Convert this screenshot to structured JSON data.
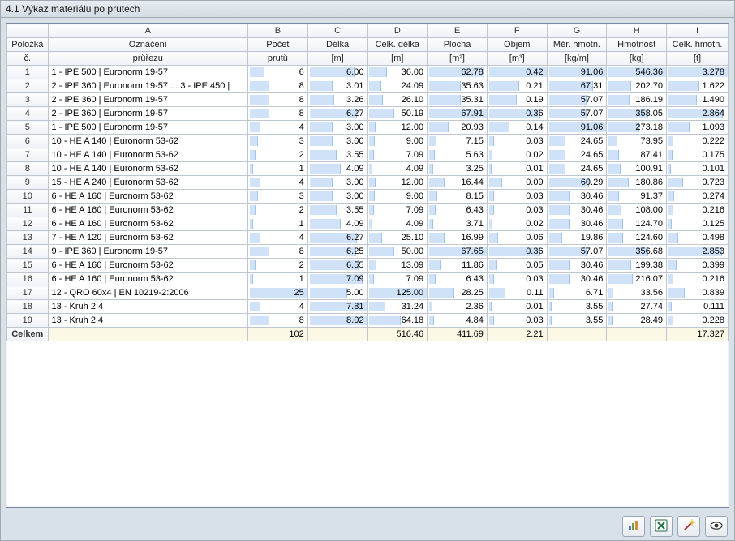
{
  "title": "4.1 Výkaz materiálu po prutech",
  "columns": {
    "letters": [
      "",
      "A",
      "B",
      "C",
      "D",
      "E",
      "F",
      "G",
      "H",
      "I"
    ],
    "row1": [
      "Položka",
      "Označení",
      "Počet",
      "Délka",
      "Celk. délka",
      "Plocha",
      "Objem",
      "Měr. hmotn.",
      "Hmotnost",
      "Celk. hmotn."
    ],
    "row2": [
      "č.",
      "průřezu",
      "prutů",
      "[m]",
      "[m]",
      "[m²]",
      "[m³]",
      "[kg/m]",
      "[kg]",
      "[t]"
    ]
  },
  "bar_max": {
    "count": 25,
    "length": 8.02,
    "total_length": 125.0,
    "area": 67.91,
    "volume": 0.42,
    "unit_mass": 91.06,
    "mass": 546.36,
    "total_mass": 3.278
  },
  "rows": [
    {
      "n": "1",
      "desc": "1 - IPE 500 | Euronorm 19-57",
      "count": 6,
      "length": "6.00",
      "total_length": "36.00",
      "area": "62.78",
      "volume": "0.42",
      "unit_mass": "91.06",
      "mass": "546.36",
      "total_mass": "3.278"
    },
    {
      "n": "2",
      "desc": "2 - IPE 360 | Euronorm 19-57 ... 3 - IPE 450 |",
      "count": 8,
      "length": "3.01",
      "total_length": "24.09",
      "area": "35.63",
      "volume": "0.21",
      "unit_mass": "67.31",
      "mass": "202.70",
      "total_mass": "1.622"
    },
    {
      "n": "3",
      "desc": "2 - IPE 360 | Euronorm 19-57",
      "count": 8,
      "length": "3.26",
      "total_length": "26.10",
      "area": "35.31",
      "volume": "0.19",
      "unit_mass": "57.07",
      "mass": "186.19",
      "total_mass": "1.490"
    },
    {
      "n": "4",
      "desc": "2 - IPE 360 | Euronorm 19-57",
      "count": 8,
      "length": "6.27",
      "total_length": "50.19",
      "area": "67.91",
      "volume": "0.36",
      "unit_mass": "57.07",
      "mass": "358.05",
      "total_mass": "2.864"
    },
    {
      "n": "5",
      "desc": "1 - IPE 500 | Euronorm 19-57",
      "count": 4,
      "length": "3.00",
      "total_length": "12.00",
      "area": "20.93",
      "volume": "0.14",
      "unit_mass": "91.06",
      "mass": "273.18",
      "total_mass": "1.093"
    },
    {
      "n": "6",
      "desc": "10 - HE A 140 | Euronorm 53-62",
      "count": 3,
      "length": "3.00",
      "total_length": "9.00",
      "area": "7.15",
      "volume": "0.03",
      "unit_mass": "24.65",
      "mass": "73.95",
      "total_mass": "0.222"
    },
    {
      "n": "7",
      "desc": "10 - HE A 140 | Euronorm 53-62",
      "count": 2,
      "length": "3.55",
      "total_length": "7.09",
      "area": "5.63",
      "volume": "0.02",
      "unit_mass": "24.65",
      "mass": "87.41",
      "total_mass": "0.175"
    },
    {
      "n": "8",
      "desc": "10 - HE A 140 | Euronorm 53-62",
      "count": 1,
      "length": "4.09",
      "total_length": "4.09",
      "area": "3.25",
      "volume": "0.01",
      "unit_mass": "24.65",
      "mass": "100.91",
      "total_mass": "0.101"
    },
    {
      "n": "9",
      "desc": "15 - HE A 240 | Euronorm 53-62",
      "count": 4,
      "length": "3.00",
      "total_length": "12.00",
      "area": "16.44",
      "volume": "0.09",
      "unit_mass": "60.29",
      "mass": "180.86",
      "total_mass": "0.723"
    },
    {
      "n": "10",
      "desc": "6 - HE A 160 | Euronorm 53-62",
      "count": 3,
      "length": "3.00",
      "total_length": "9.00",
      "area": "8.15",
      "volume": "0.03",
      "unit_mass": "30.46",
      "mass": "91.37",
      "total_mass": "0.274"
    },
    {
      "n": "11",
      "desc": "6 - HE A 160 | Euronorm 53-62",
      "count": 2,
      "length": "3.55",
      "total_length": "7.09",
      "area": "6.43",
      "volume": "0.03",
      "unit_mass": "30.46",
      "mass": "108.00",
      "total_mass": "0.216"
    },
    {
      "n": "12",
      "desc": "6 - HE A 160 | Euronorm 53-62",
      "count": 1,
      "length": "4.09",
      "total_length": "4.09",
      "area": "3.71",
      "volume": "0.02",
      "unit_mass": "30.46",
      "mass": "124.70",
      "total_mass": "0.125"
    },
    {
      "n": "13",
      "desc": "7 - HE A 120 | Euronorm 53-62",
      "count": 4,
      "length": "6.27",
      "total_length": "25.10",
      "area": "16.99",
      "volume": "0.06",
      "unit_mass": "19.86",
      "mass": "124.60",
      "total_mass": "0.498"
    },
    {
      "n": "14",
      "desc": "9 - IPE 360 | Euronorm 19-57",
      "count": 8,
      "length": "6.25",
      "total_length": "50.00",
      "area": "67.65",
      "volume": "0.36",
      "unit_mass": "57.07",
      "mass": "356.68",
      "total_mass": "2.853"
    },
    {
      "n": "15",
      "desc": "6 - HE A 160 | Euronorm 53-62",
      "count": 2,
      "length": "6.55",
      "total_length": "13.09",
      "area": "11.86",
      "volume": "0.05",
      "unit_mass": "30.46",
      "mass": "199.38",
      "total_mass": "0.399"
    },
    {
      "n": "16",
      "desc": "6 - HE A 160 | Euronorm 53-62",
      "count": 1,
      "length": "7.09",
      "total_length": "7.09",
      "area": "6.43",
      "volume": "0.03",
      "unit_mass": "30.46",
      "mass": "216.07",
      "total_mass": "0.216"
    },
    {
      "n": "17",
      "desc": "12 - QRO 60x4 | EN 10219-2:2006",
      "count": 25,
      "length": "5.00",
      "total_length": "125.00",
      "area": "28.25",
      "volume": "0.11",
      "unit_mass": "6.71",
      "mass": "33.56",
      "total_mass": "0.839"
    },
    {
      "n": "18",
      "desc": "13 - Kruh 2.4",
      "count": 4,
      "length": "7.81",
      "total_length": "31.24",
      "area": "2.36",
      "volume": "0.01",
      "unit_mass": "3.55",
      "mass": "27.74",
      "total_mass": "0.111"
    },
    {
      "n": "19",
      "desc": "13 - Kruh 2.4",
      "count": 8,
      "length": "8.02",
      "total_length": "64.18",
      "area": "4.84",
      "volume": "0.03",
      "unit_mass": "3.55",
      "mass": "28.49",
      "total_mass": "0.228"
    }
  ],
  "totals": {
    "label": "Celkem",
    "count": "102",
    "total_length": "516.46",
    "area": "411.69",
    "volume": "2.21",
    "total_mass": "17.327"
  },
  "toolbar": {
    "btn_chart": "Chart",
    "btn_excel": "Export to Excel",
    "btn_filter": "Filter",
    "btn_view": "View"
  }
}
